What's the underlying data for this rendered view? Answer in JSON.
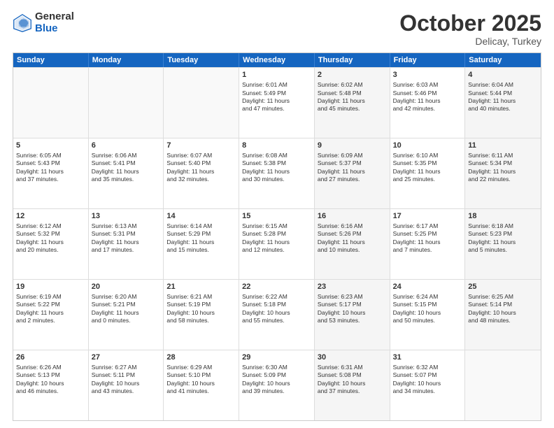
{
  "logo": {
    "general": "General",
    "blue": "Blue"
  },
  "title": "October 2025",
  "subtitle": "Delicay, Turkey",
  "days": [
    "Sunday",
    "Monday",
    "Tuesday",
    "Wednesday",
    "Thursday",
    "Friday",
    "Saturday"
  ],
  "rows": [
    [
      {
        "day": "",
        "text": "",
        "shaded": false,
        "empty": true
      },
      {
        "day": "",
        "text": "",
        "shaded": false,
        "empty": true
      },
      {
        "day": "",
        "text": "",
        "shaded": false,
        "empty": true
      },
      {
        "day": "1",
        "text": "Sunrise: 6:01 AM\nSunset: 5:49 PM\nDaylight: 11 hours\nand 47 minutes.",
        "shaded": false
      },
      {
        "day": "2",
        "text": "Sunrise: 6:02 AM\nSunset: 5:48 PM\nDaylight: 11 hours\nand 45 minutes.",
        "shaded": true
      },
      {
        "day": "3",
        "text": "Sunrise: 6:03 AM\nSunset: 5:46 PM\nDaylight: 11 hours\nand 42 minutes.",
        "shaded": false
      },
      {
        "day": "4",
        "text": "Sunrise: 6:04 AM\nSunset: 5:44 PM\nDaylight: 11 hours\nand 40 minutes.",
        "shaded": true
      }
    ],
    [
      {
        "day": "5",
        "text": "Sunrise: 6:05 AM\nSunset: 5:43 PM\nDaylight: 11 hours\nand 37 minutes.",
        "shaded": false
      },
      {
        "day": "6",
        "text": "Sunrise: 6:06 AM\nSunset: 5:41 PM\nDaylight: 11 hours\nand 35 minutes.",
        "shaded": false
      },
      {
        "day": "7",
        "text": "Sunrise: 6:07 AM\nSunset: 5:40 PM\nDaylight: 11 hours\nand 32 minutes.",
        "shaded": false
      },
      {
        "day": "8",
        "text": "Sunrise: 6:08 AM\nSunset: 5:38 PM\nDaylight: 11 hours\nand 30 minutes.",
        "shaded": false
      },
      {
        "day": "9",
        "text": "Sunrise: 6:09 AM\nSunset: 5:37 PM\nDaylight: 11 hours\nand 27 minutes.",
        "shaded": true
      },
      {
        "day": "10",
        "text": "Sunrise: 6:10 AM\nSunset: 5:35 PM\nDaylight: 11 hours\nand 25 minutes.",
        "shaded": false
      },
      {
        "day": "11",
        "text": "Sunrise: 6:11 AM\nSunset: 5:34 PM\nDaylight: 11 hours\nand 22 minutes.",
        "shaded": true
      }
    ],
    [
      {
        "day": "12",
        "text": "Sunrise: 6:12 AM\nSunset: 5:32 PM\nDaylight: 11 hours\nand 20 minutes.",
        "shaded": false
      },
      {
        "day": "13",
        "text": "Sunrise: 6:13 AM\nSunset: 5:31 PM\nDaylight: 11 hours\nand 17 minutes.",
        "shaded": false
      },
      {
        "day": "14",
        "text": "Sunrise: 6:14 AM\nSunset: 5:29 PM\nDaylight: 11 hours\nand 15 minutes.",
        "shaded": false
      },
      {
        "day": "15",
        "text": "Sunrise: 6:15 AM\nSunset: 5:28 PM\nDaylight: 11 hours\nand 12 minutes.",
        "shaded": false
      },
      {
        "day": "16",
        "text": "Sunrise: 6:16 AM\nSunset: 5:26 PM\nDaylight: 11 hours\nand 10 minutes.",
        "shaded": true
      },
      {
        "day": "17",
        "text": "Sunrise: 6:17 AM\nSunset: 5:25 PM\nDaylight: 11 hours\nand 7 minutes.",
        "shaded": false
      },
      {
        "day": "18",
        "text": "Sunrise: 6:18 AM\nSunset: 5:23 PM\nDaylight: 11 hours\nand 5 minutes.",
        "shaded": true
      }
    ],
    [
      {
        "day": "19",
        "text": "Sunrise: 6:19 AM\nSunset: 5:22 PM\nDaylight: 11 hours\nand 2 minutes.",
        "shaded": false
      },
      {
        "day": "20",
        "text": "Sunrise: 6:20 AM\nSunset: 5:21 PM\nDaylight: 11 hours\nand 0 minutes.",
        "shaded": false
      },
      {
        "day": "21",
        "text": "Sunrise: 6:21 AM\nSunset: 5:19 PM\nDaylight: 10 hours\nand 58 minutes.",
        "shaded": false
      },
      {
        "day": "22",
        "text": "Sunrise: 6:22 AM\nSunset: 5:18 PM\nDaylight: 10 hours\nand 55 minutes.",
        "shaded": false
      },
      {
        "day": "23",
        "text": "Sunrise: 6:23 AM\nSunset: 5:17 PM\nDaylight: 10 hours\nand 53 minutes.",
        "shaded": true
      },
      {
        "day": "24",
        "text": "Sunrise: 6:24 AM\nSunset: 5:15 PM\nDaylight: 10 hours\nand 50 minutes.",
        "shaded": false
      },
      {
        "day": "25",
        "text": "Sunrise: 6:25 AM\nSunset: 5:14 PM\nDaylight: 10 hours\nand 48 minutes.",
        "shaded": true
      }
    ],
    [
      {
        "day": "26",
        "text": "Sunrise: 6:26 AM\nSunset: 5:13 PM\nDaylight: 10 hours\nand 46 minutes.",
        "shaded": false
      },
      {
        "day": "27",
        "text": "Sunrise: 6:27 AM\nSunset: 5:11 PM\nDaylight: 10 hours\nand 43 minutes.",
        "shaded": false
      },
      {
        "day": "28",
        "text": "Sunrise: 6:29 AM\nSunset: 5:10 PM\nDaylight: 10 hours\nand 41 minutes.",
        "shaded": false
      },
      {
        "day": "29",
        "text": "Sunrise: 6:30 AM\nSunset: 5:09 PM\nDaylight: 10 hours\nand 39 minutes.",
        "shaded": false
      },
      {
        "day": "30",
        "text": "Sunrise: 6:31 AM\nSunset: 5:08 PM\nDaylight: 10 hours\nand 37 minutes.",
        "shaded": true
      },
      {
        "day": "31",
        "text": "Sunrise: 6:32 AM\nSunset: 5:07 PM\nDaylight: 10 hours\nand 34 minutes.",
        "shaded": false
      },
      {
        "day": "",
        "text": "",
        "shaded": true,
        "empty": true
      }
    ]
  ]
}
